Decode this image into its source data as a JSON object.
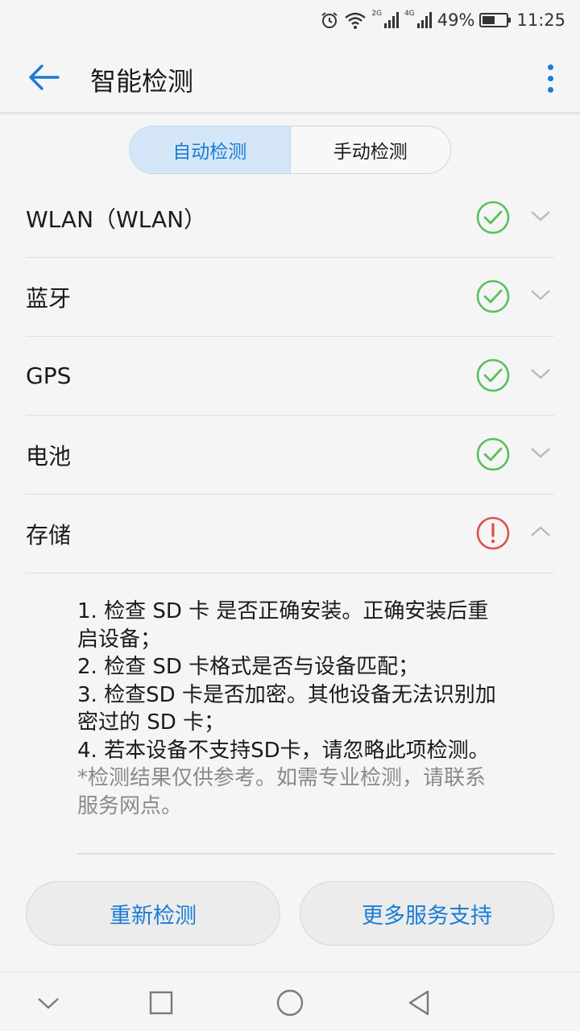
{
  "status_bar": {
    "network_1": "2G",
    "network_2": "4G",
    "battery": "49%",
    "time": "11:25",
    "icons": [
      "alarm-icon",
      "wifi-icon",
      "signal-icon",
      "signal-icon",
      "battery-icon"
    ]
  },
  "header": {
    "title": "智能检测",
    "back_icon": "arrow-left-icon",
    "menu_icon": "more-vertical-icon"
  },
  "tabs": {
    "auto": "自动检测",
    "manual": "手动检测",
    "selected": "auto"
  },
  "checks": [
    {
      "label": "WLAN（WLAN）",
      "status": "ok",
      "expanded": false
    },
    {
      "label": "蓝牙",
      "status": "ok",
      "expanded": false
    },
    {
      "label": "GPS",
      "status": "ok",
      "expanded": false
    },
    {
      "label": "电池",
      "status": "ok",
      "expanded": false
    },
    {
      "label": "存储",
      "status": "error",
      "expanded": true
    }
  ],
  "storage_details": {
    "line1": "1. 检查 SD 卡 是否正确安装。正确安装后重",
    "line2": "启设备；",
    "line3": "2. 检查 SD 卡格式是否与设备匹配；",
    "line4": "3. 检查SD 卡是否加密。其他设备无法识别加",
    "line5": "密过的 SD 卡；",
    "line6": "4. 若本设备不支持SD卡，请忽略此项检测。",
    "note1": "*检测结果仅供参考。如需专业检测，请联系",
    "note2": "服务网点。"
  },
  "buttons": {
    "recheck": "重新检测",
    "more_support": "更多服务支持"
  },
  "nav": {
    "icons": [
      "chevron-down-icon",
      "square-icon",
      "circle-icon",
      "triangle-back-icon"
    ]
  },
  "colors": {
    "accent": "#1a7cd6",
    "ok": "#5cbf5c",
    "error": "#e0504a",
    "tab_selected_bg": "#d4e6f7"
  }
}
